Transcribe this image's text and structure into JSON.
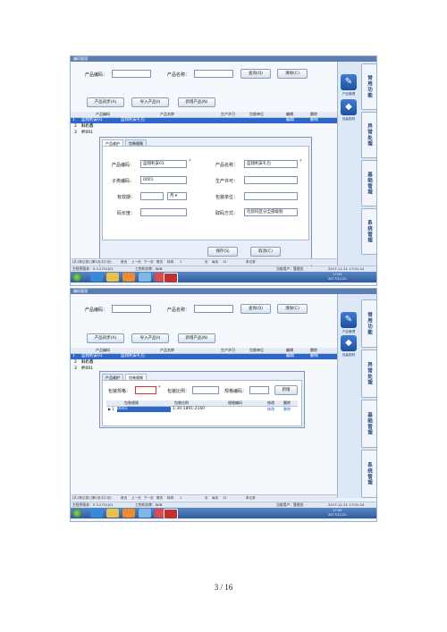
{
  "common": {
    "window_title": "编码管理",
    "search": {
      "code_label": "产品编码：",
      "name_label": "产品名称：",
      "query_button": "查询(Q)",
      "clear_button": "清除(C)"
    },
    "toolbar": {
      "sync_button": "产品同步(A)",
      "import_button": "导入产品(I)",
      "new_button": "新增产品(N)"
    },
    "grid_headers": [
      "产品编码",
      "产品名称",
      "生产许可",
      "包装单位",
      "编辑",
      "删除"
    ],
    "grid_rows": [
      {
        "no": "1",
        "code": "蓝翔利安01",
        "name": "蓝翔利安礼包"
      },
      {
        "no": "2",
        "code": "鲜奶鑫",
        "name": ""
      },
      {
        "no": "3",
        "code": "杯001",
        "name": ""
      }
    ],
    "row_edit": "编辑",
    "row_delete": "删除",
    "statusbar": [
      "[共1条记录] [第1页/共1页]",
      "首页",
      "上一页",
      "下一页",
      "尾页",
      "转到",
      "1",
      "页",
      "每页",
      "15",
      "条记录"
    ],
    "infobar": {
      "version": "主程序版本：5.3.2721(0)",
      "company": "工控机名称：WIN",
      "user": "当前用户：管理员",
      "datetime": "2017-11-21 17:01:41"
    },
    "tray": {
      "time": "17:02",
      "date": "2017/11/21"
    },
    "side": {
      "product_caption": "产品管理",
      "label_caption": "包装规则",
      "tabs": [
        "常用功能",
        "异常处理",
        "基础管理",
        "系统管理"
      ]
    }
  },
  "dialog1": {
    "tabs": [
      "产品维护",
      "包装规格"
    ],
    "fields": {
      "product_code_label": "产品编码：",
      "product_code_value": "蓝翔利安01",
      "product_name_label": "产品名称：",
      "product_name_value": "蓝翔利安礼包",
      "sub_code_label": "子类编码：",
      "sub_code_value": "0001",
      "license_label": "生产许可：",
      "validity_label": "有效期：",
      "validity_unit": "月",
      "pack_unit_label": "包装单位：",
      "code_length_label": "码长度：",
      "fetch_label": "取码方式：",
      "fetch_value": "包装码区分全部级别"
    },
    "save_button": "保存(S)",
    "cancel_button": "取消(C)"
  },
  "dialog2": {
    "tabs": [
      "产品维护",
      "包装规格"
    ],
    "pack_spec_label": "包装规格：",
    "pack_ratio_label": "包装比例：",
    "spec_code_label": "规格编码：",
    "new_button": "新增",
    "table_headers": [
      "包装规格",
      "包装比例",
      "规格编码",
      "修改",
      "删除"
    ],
    "table_rows": [
      {
        "marker": "▶ 1",
        "spec": "0001",
        "ratio": "1:30:1891:2160",
        "code": "",
        "edit": "修改",
        "delete": "删除"
      }
    ]
  },
  "infobar2": {
    "datetime": "2017-11-21 17:01:24"
  },
  "tray2": {
    "time": "17:04",
    "date": "2017/11/21"
  },
  "page_number": "3 / 16"
}
